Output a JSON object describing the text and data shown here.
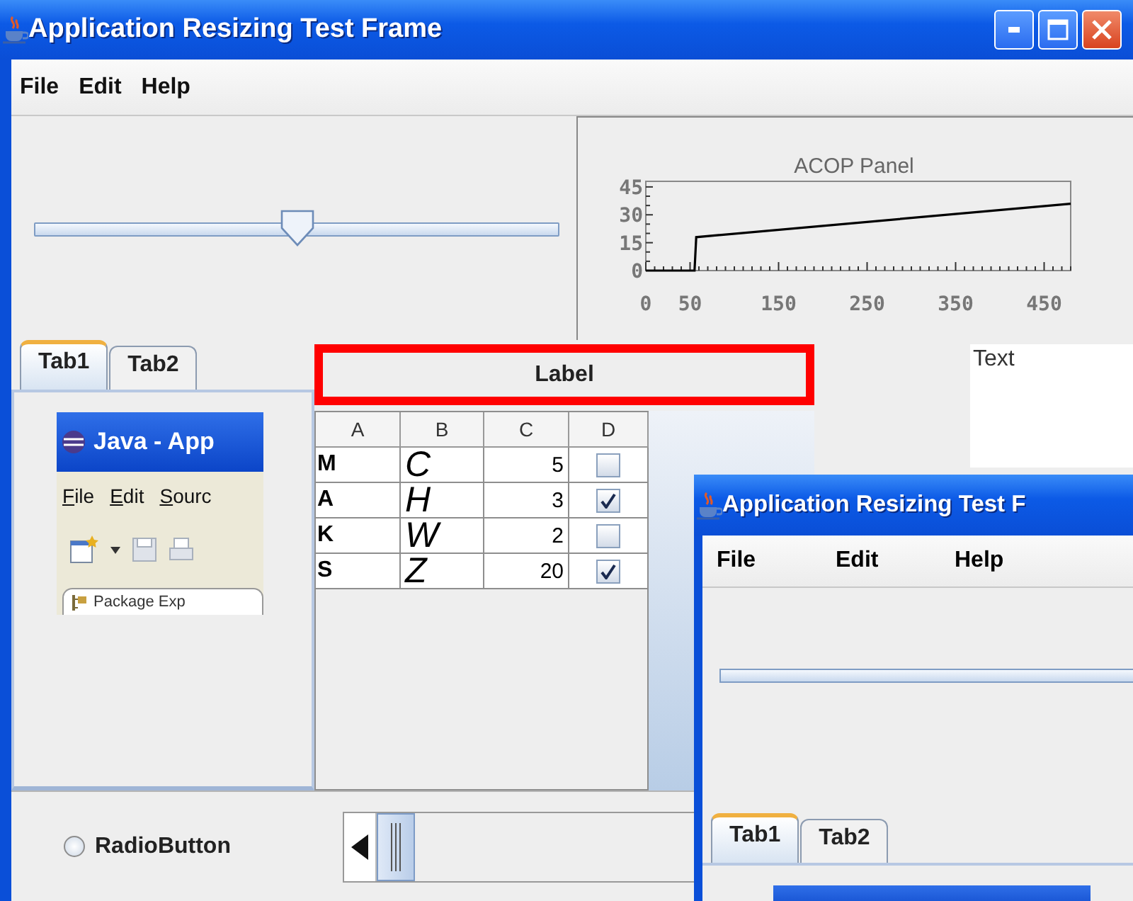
{
  "window": {
    "title": "Application Resizing Test Frame"
  },
  "menu": [
    "File",
    "Edit",
    "Help"
  ],
  "slider": {
    "level": 0.5
  },
  "chart_panel": {
    "chart_data": {
      "type": "line",
      "title": "ACOP Panel",
      "x": [
        0,
        55,
        57,
        480
      ],
      "values": [
        0,
        0,
        18,
        36
      ],
      "xlim": [
        0,
        480
      ],
      "ylim": [
        0,
        48
      ],
      "xticks": [
        0,
        50,
        150,
        250,
        350,
        450
      ],
      "yticks": [
        0,
        15,
        30,
        45
      ]
    }
  },
  "tabs": [
    {
      "label": "Tab1",
      "selected": true
    },
    {
      "label": "Tab2",
      "selected": false
    }
  ],
  "embedded_screenshot": {
    "title": "Java - App",
    "menu": [
      "File",
      "Edit",
      "Sourc"
    ],
    "view_tab": "Package Exp"
  },
  "label": "Label",
  "table": {
    "columns": [
      "A",
      "B",
      "C",
      "D"
    ],
    "rows": [
      {
        "cells": [
          "M",
          "C",
          "5"
        ],
        "checked": false
      },
      {
        "cells": [
          "A",
          "H",
          "3"
        ],
        "checked": true
      },
      {
        "cells": [
          "K",
          "W",
          "2"
        ],
        "checked": false
      },
      {
        "cells": [
          "S",
          "Z",
          "20"
        ],
        "checked": true
      }
    ]
  },
  "text_area": {
    "value": "Text"
  },
  "radio_button": {
    "label": "RadioButton",
    "selected": false
  },
  "child_window": {
    "title": "Application Resizing Test F",
    "menu": [
      "File",
      "Edit",
      "Help"
    ],
    "tabs": [
      {
        "label": "Tab1",
        "selected": true
      },
      {
        "label": "Tab2",
        "selected": false
      }
    ]
  }
}
